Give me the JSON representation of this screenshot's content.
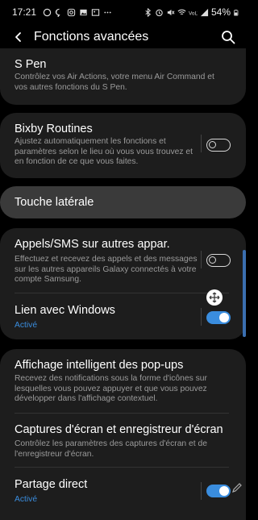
{
  "status_bar": {
    "time": "17:21",
    "battery": "54%",
    "icons_left": [
      "whatsapp-icon",
      "messenger-icon",
      "instagram-icon",
      "gallery-icon",
      "image-icon",
      "more-dots-icon"
    ],
    "icons_right": [
      "bluetooth-icon",
      "alarm-icon",
      "mute-icon",
      "wifi-icon",
      "volte-icon",
      "signal-icon",
      "battery-icon"
    ]
  },
  "app_bar": {
    "title": "Fonctions avancées",
    "back_icon": "back-arrow-icon",
    "search_icon": "search-icon"
  },
  "items": {
    "spen": {
      "title": "S Pen",
      "desc": "Contrôlez vos Air Actions, votre menu Air Command et vos autres fonctions du S Pen."
    },
    "bixby": {
      "title": "Bixby Routines",
      "desc": "Ajustez automatiquement les fonctions et paramètres selon le lieu où vous vous trouvez et en fonction de ce que vous faites.",
      "enabled": false
    },
    "side_key": {
      "title": "Touche latérale"
    },
    "calls_sms": {
      "title": "Appels/SMS sur autres appar.",
      "desc": "Effectuez et recevez des appels et des messages sur les autres appareils Galaxy connectés à votre compte Samsung.",
      "enabled": false
    },
    "link_windows": {
      "title": "Lien avec Windows",
      "status": "Activé",
      "enabled": true
    },
    "smart_popup": {
      "title": "Affichage intelligent des pop-ups",
      "desc": "Recevez des notifications sous la forme d'icônes sur lesquelles vous pouvez appuyer et que vous pouvez développer dans l'affichage contextuel."
    },
    "screenshots": {
      "title": "Captures d'écran et enregistreur d'écran",
      "desc": "Contrôlez les paramètres des captures d'écran et de l'enregistreur d'écran."
    },
    "direct_share": {
      "title": "Partage direct",
      "status": "Activé",
      "enabled": true
    }
  },
  "colors": {
    "accent": "#3a8dde",
    "card": "#1d1d1d",
    "highlight_card": "#3a3a3a",
    "background": "#000000",
    "secondary_text": "#9b9b9b"
  }
}
